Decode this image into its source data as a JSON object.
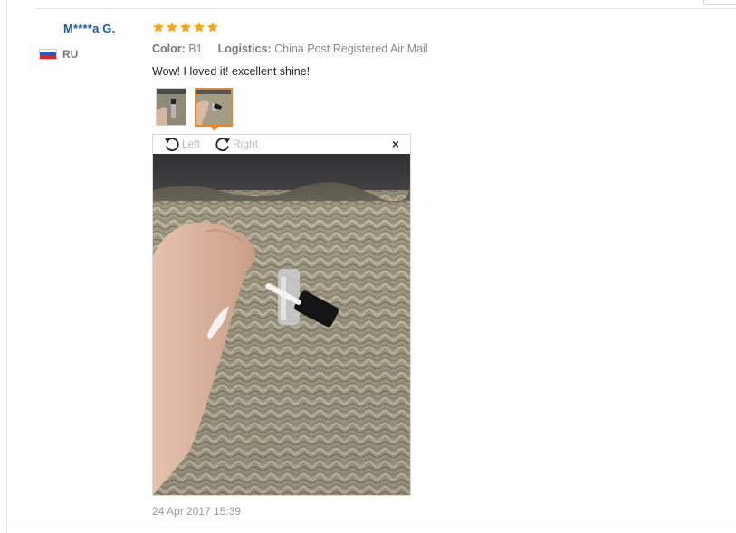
{
  "review": {
    "username": "M****a G.",
    "country": "RU",
    "rating": 5,
    "color_label": "Color:",
    "color_value": "B1",
    "logistics_label": "Logistics:",
    "logistics_value": "China Post Registered Air Mail",
    "text": "Wow! I loved it! excellent shine!",
    "date": "24 Apr 2017 15:39"
  },
  "viewer": {
    "rotate_left_label": "Left",
    "rotate_right_label": "Right",
    "close_label": "×"
  },
  "colors": {
    "username": "#1c5aa8",
    "star": "#f5a623",
    "thumb_active_border": "#f0822a"
  },
  "icons": {
    "star": "star-icon",
    "rotate_left": "rotate-left-icon",
    "rotate_right": "rotate-right-icon",
    "close": "close-icon",
    "flag": "russia-flag-icon"
  }
}
